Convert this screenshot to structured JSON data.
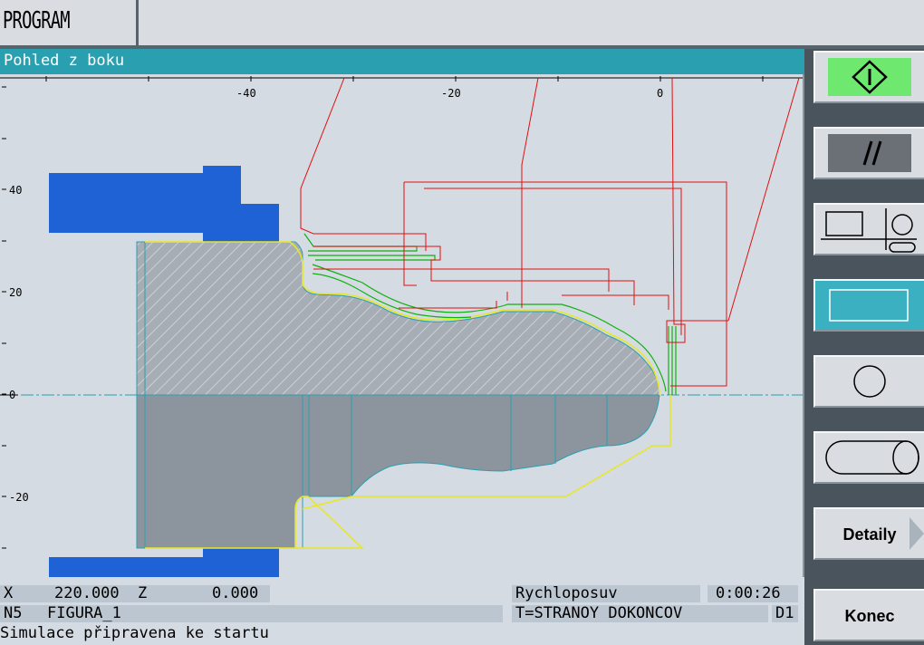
{
  "header": {
    "mode": "PROGRAM"
  },
  "view": {
    "title": "Pohled z boku",
    "x_ticks": [
      "-40",
      "-20",
      "0"
    ],
    "y_ticks": [
      "40",
      "20",
      "0",
      "-20"
    ]
  },
  "status": {
    "x_label": "X",
    "x_value": "220.000",
    "z_label": "Z",
    "z_value": "0.000",
    "feed_mode": "Rychloposuv",
    "time": "0:00:26",
    "block": "N5",
    "program": "FIGURA_1",
    "tool": "T=STRANOY DOKONCOV",
    "offset": "D1",
    "message": "Simulace připravena ke startu"
  },
  "softkeys": {
    "detail_label": "Detaily",
    "end_label": "Konec"
  },
  "colors": {
    "accent": "#2a9fb0",
    "start_green": "#6fe86f",
    "part_gray": "#8c959e",
    "chuck_blue": "#1f62d6",
    "rapid_red": "#e01010",
    "feed_green": "#10b010",
    "contour_yellow": "#e8e820"
  }
}
